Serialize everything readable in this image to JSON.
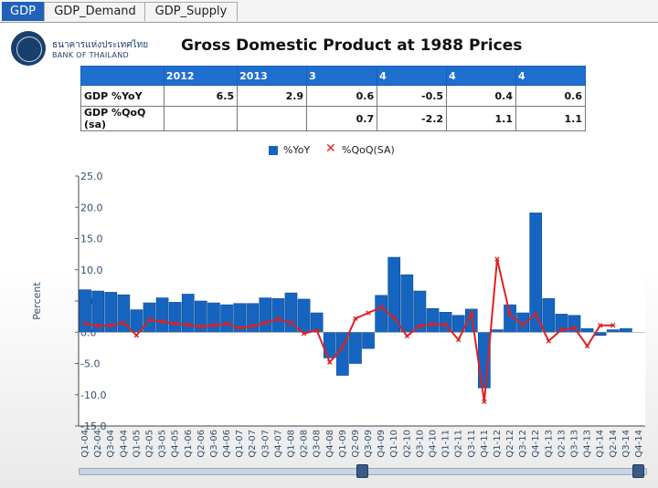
{
  "tabs": [
    "GDP",
    "GDP_Demand",
    "GDP_Supply"
  ],
  "active_tab": 0,
  "logo": {
    "thai": "ธนาคารแห่งประเทศไทย",
    "english": "BANK OF THAILAND"
  },
  "title": "Gross Domestic Product at 1988 Prices",
  "table": {
    "headers": [
      "",
      "2012",
      "2013",
      "3",
      "4",
      "4",
      "4"
    ],
    "rows": [
      {
        "label": "GDP %YoY",
        "values": [
          "6.5",
          "2.9",
          "0.6",
          "-0.5",
          "0.4",
          "0.6"
        ]
      },
      {
        "label": "GDP %QoQ (sa)",
        "values": [
          "",
          "",
          "0.7",
          "-2.2",
          "1.1",
          "1.1"
        ]
      }
    ]
  },
  "legend": {
    "yoy": "%YoY",
    "qoq": "%QoQ(SA)"
  },
  "chart_data": {
    "type": "bar",
    "ylabel": "Percent",
    "ylim": [
      -15,
      25
    ],
    "yticks": [
      "25.0",
      "20.0",
      "15.0",
      "10.0",
      "5.0",
      "0.0",
      "-5.0",
      "-10.0",
      "-15.0"
    ],
    "categories": [
      "Q1-04",
      "Q2-04",
      "Q3-04",
      "Q4-04",
      "Q1-05",
      "Q2-05",
      "Q3-05",
      "Q4-05",
      "Q1-06",
      "Q2-06",
      "Q3-06",
      "Q4-06",
      "Q1-07",
      "Q2-07",
      "Q3-07",
      "Q4-07",
      "Q1-08",
      "Q2-08",
      "Q3-08",
      "Q4-08",
      "Q1-09",
      "Q2-09",
      "Q3-09",
      "Q4-09",
      "Q1-10",
      "Q2-10",
      "Q3-10",
      "Q4-10",
      "Q1-11",
      "Q2-11",
      "Q3-11",
      "Q4-11",
      "Q1-12",
      "Q2-12",
      "Q3-12",
      "Q4-12",
      "Q1-13",
      "Q2-13",
      "Q3-13",
      "Q4-13",
      "Q1-14",
      "Q2-14",
      "Q3-14",
      "Q4-14"
    ],
    "series": [
      {
        "name": "%YoY",
        "type": "bar",
        "color": "#1565c0",
        "values": [
          6.8,
          6.6,
          6.4,
          6.0,
          3.6,
          4.7,
          5.5,
          4.8,
          6.1,
          5.0,
          4.7,
          4.4,
          4.6,
          4.6,
          5.5,
          5.4,
          6.3,
          5.3,
          3.1,
          -4.1,
          -6.9,
          -5.0,
          -2.6,
          5.9,
          12.0,
          9.2,
          6.6,
          3.8,
          3.2,
          2.7,
          3.7,
          -8.9,
          0.4,
          4.4,
          3.1,
          19.1,
          5.4,
          2.9,
          2.7,
          0.6,
          -0.5,
          0.4,
          0.6,
          null
        ]
      },
      {
        "name": "%QoQ(SA)",
        "type": "line",
        "color": "#e02020",
        "values": [
          1.4,
          1.0,
          1.1,
          1.5,
          -0.5,
          2.0,
          1.7,
          1.4,
          1.2,
          0.9,
          1.1,
          1.4,
          0.7,
          1.0,
          1.5,
          2.1,
          1.5,
          -0.2,
          0.3,
          -4.8,
          -2.4,
          2.2,
          3.1,
          4.0,
          2.3,
          -0.6,
          1.0,
          1.3,
          1.2,
          -1.2,
          3.0,
          -11.1,
          11.7,
          2.8,
          1.2,
          2.9,
          -1.4,
          0.4,
          0.7,
          -2.2,
          1.1,
          1.1,
          null,
          null
        ]
      }
    ]
  }
}
